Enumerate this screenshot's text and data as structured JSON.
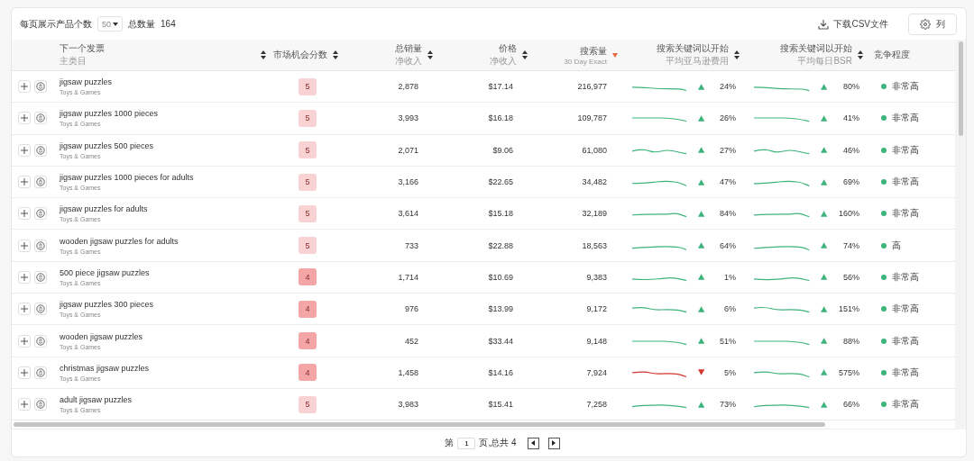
{
  "toolbar": {
    "per_page_label": "每页展示产品个数",
    "per_page_value": "50",
    "total_label": "总数量",
    "total_value": "164",
    "download_label": "下载CSV文件",
    "columns_label": "列"
  },
  "columns": [
    {
      "kind": "name",
      "label": "下一个发票",
      "sublabel": "主类目",
      "sorted": false
    },
    {
      "kind": "score",
      "label": "市场机会分数",
      "sorted": false
    },
    {
      "kind": "number",
      "label": "总销量",
      "sublabel": "净收入",
      "sorted": false
    },
    {
      "kind": "number",
      "label": "价格",
      "sublabel": "净收入",
      "sorted": false
    },
    {
      "kind": "number",
      "label": "搜索量",
      "sublabel": "30 Day Exact",
      "sorted": true
    },
    {
      "kind": "trend",
      "label": "搜索关键词以开始",
      "sublabel": "平均亚马逊费用",
      "sorted": false
    },
    {
      "kind": "trend",
      "label": "搜索关键词以开始",
      "sublabel": "平均每日BSR",
      "sorted": false
    },
    {
      "kind": "plain",
      "label": "竞争程度"
    }
  ],
  "rows": [
    {
      "keyword": "jigsaw puzzles",
      "category": "Toys & Games",
      "score": "5",
      "color": "#f9d3d3",
      "sales": "2,878",
      "price": "$17.14",
      "search_volume": "216,977",
      "rising_1": true,
      "change_1": "24%",
      "rising_2": true,
      "change_2": "80%",
      "competition": "非常高"
    },
    {
      "keyword": "jigsaw puzzles 1000 pieces",
      "category": "Toys & Games",
      "score": "5",
      "color": "#f9d3d3",
      "sales": "3,993",
      "price": "$16.18",
      "search_volume": "109,787",
      "rising_1": true,
      "change_1": "26%",
      "rising_2": true,
      "change_2": "41%",
      "competition": "非常高"
    },
    {
      "keyword": "jigsaw puzzles 500 pieces",
      "category": "Toys & Games",
      "score": "5",
      "color": "#f9d3d3",
      "sales": "2,071",
      "price": "$9.06",
      "search_volume": "61,080",
      "rising_1": true,
      "change_1": "27%",
      "rising_2": true,
      "change_2": "46%",
      "competition": "非常高"
    },
    {
      "keyword": "jigsaw puzzles 1000 pieces for adults",
      "category": "Toys & Games",
      "score": "5",
      "color": "#f9d3d3",
      "sales": "3,166",
      "price": "$22.65",
      "search_volume": "34,482",
      "rising_1": true,
      "change_1": "47%",
      "rising_2": true,
      "change_2": "69%",
      "competition": "非常高"
    },
    {
      "keyword": "jigsaw puzzles for adults",
      "category": "Toys & Games",
      "score": "5",
      "color": "#f9d3d3",
      "sales": "3,614",
      "price": "$15.18",
      "search_volume": "32,189",
      "rising_1": true,
      "change_1": "84%",
      "rising_2": true,
      "change_2": "160%",
      "competition": "非常高"
    },
    {
      "keyword": "wooden jigsaw puzzles for adults",
      "category": "Toys & Games",
      "score": "5",
      "color": "#f9d3d3",
      "sales": "733",
      "price": "$22.88",
      "search_volume": "18,563",
      "rising_1": true,
      "change_1": "64%",
      "rising_2": true,
      "change_2": "74%",
      "competition": "高"
    },
    {
      "keyword": "500 piece jigsaw puzzles",
      "category": "Toys & Games",
      "score": "4",
      "color": "#f4a6a6",
      "sales": "1,714",
      "price": "$10.69",
      "search_volume": "9,383",
      "rising_1": true,
      "change_1": "1%",
      "rising_2": true,
      "change_2": "56%",
      "competition": "非常高"
    },
    {
      "keyword": "jigsaw puzzles 300 pieces",
      "category": "Toys & Games",
      "score": "4",
      "color": "#f4a6a6",
      "sales": "976",
      "price": "$13.99",
      "search_volume": "9,172",
      "rising_1": true,
      "change_1": "6%",
      "rising_2": true,
      "change_2": "151%",
      "competition": "非常高"
    },
    {
      "keyword": "wooden jigsaw puzzles",
      "category": "Toys & Games",
      "score": "4",
      "color": "#f4a6a6",
      "sales": "452",
      "price": "$33.44",
      "search_volume": "9,148",
      "rising_1": true,
      "change_1": "51%",
      "rising_2": true,
      "change_2": "88%",
      "competition": "非常高"
    },
    {
      "keyword": "christmas jigsaw puzzles",
      "category": "Toys & Games",
      "score": "4",
      "color": "#f4a6a6",
      "sales": "1,458",
      "price": "$14.16",
      "search_volume": "7,924",
      "rising_1": false,
      "change_1": "5%",
      "rising_2": true,
      "change_2": "575%",
      "competition": "非常高"
    },
    {
      "keyword": "adult jigsaw puzzles",
      "category": "Toys & Games",
      "score": "5",
      "color": "#f9d3d3",
      "sales": "3,983",
      "price": "$15.41",
      "search_volume": "7,258",
      "rising_1": true,
      "change_1": "73%",
      "rising_2": true,
      "change_2": "66%",
      "competition": "非常高"
    }
  ],
  "pagination": {
    "prefix": "第",
    "page": "1",
    "suffix": "页,总共 4"
  }
}
